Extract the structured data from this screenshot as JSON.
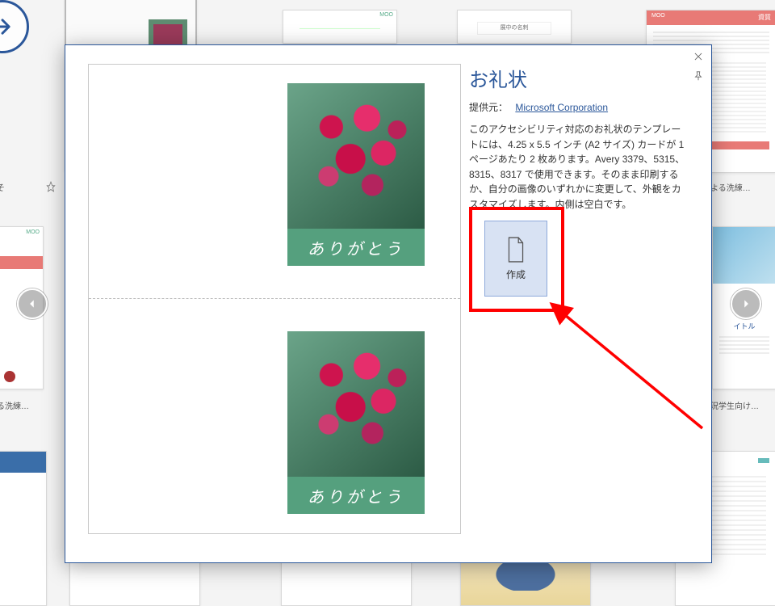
{
  "modal": {
    "title": "お礼状",
    "provider_label": "提供元：",
    "provider_name": "Microsoft Corporation",
    "description": "このアクセシビリティ対応のお礼状のテンプレートには、4.25 x 5.5 インチ (A2 サイズ) カードが 1 ページあたり 2 枚あります。Avery 3379、5315、8315、8317 で使用できます。そのまま印刷するか、自分の画像のいずれかに変更して、外観をカスタマイズします。内側は空白です。",
    "create_label": "作成",
    "card_text": "ありがとう",
    "close_tooltip": "閉じる",
    "pin_tooltip": "ピン留め"
  },
  "nav": {
    "prev_tooltip": "前へ",
    "next_tooltip": "次へ"
  },
  "bg": {
    "moo_tag": "MOO",
    "tile_titles": {
      "r0c3": "展中の名刺",
      "r0c5": "資質",
      "r1_left": "そ",
      "r1_right": "による洗練…",
      "r2_mid_title": "イトル",
      "r2_left": "る洗練…",
      "r2_right": "況学生向け…"
    }
  }
}
